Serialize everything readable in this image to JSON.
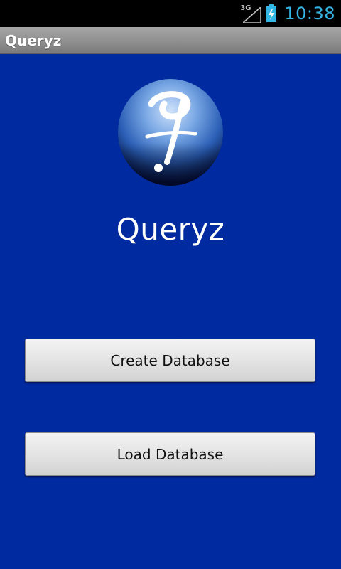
{
  "status_bar": {
    "network_type": "3G",
    "time": "10:38",
    "clock_color": "#33b5e5",
    "icons": [
      "signal-icon",
      "battery-charging-icon"
    ]
  },
  "title_bar": {
    "title": "Queryz"
  },
  "main": {
    "background_color": "#002a9f",
    "logo_icon": "queryz-logo-icon",
    "app_name": "Queryz",
    "buttons": {
      "create_label": "Create Database",
      "load_label": "Load Database"
    }
  }
}
